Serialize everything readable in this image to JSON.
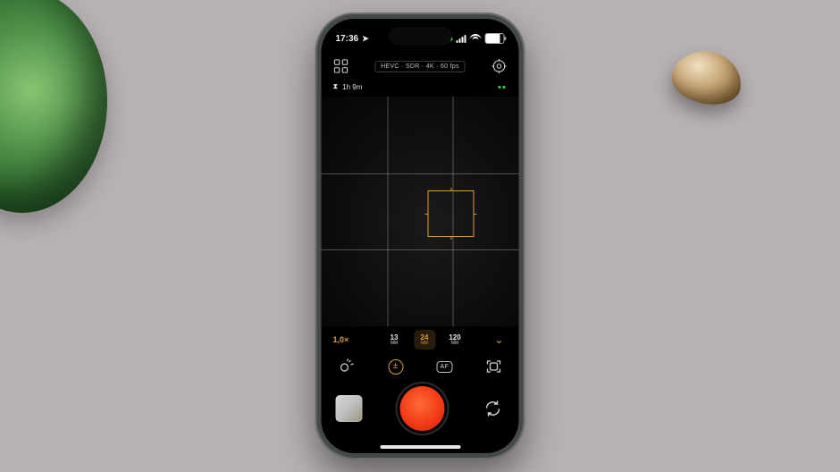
{
  "status": {
    "time": "17:36",
    "location_services": true,
    "battery_pct": 80
  },
  "header": {
    "format": "HEVC · SDR · 4K · 60 fps",
    "remaining": "1h 9m"
  },
  "lenses": {
    "zoom": "1,0×",
    "options": [
      {
        "mm": "13",
        "unit": "MM",
        "selected": false
      },
      {
        "mm": "24",
        "unit": "MM",
        "selected": true
      },
      {
        "mm": "120",
        "unit": "MM",
        "selected": false
      }
    ]
  },
  "tools": {
    "af": "AF"
  },
  "colors": {
    "accent": "#d7a03a",
    "record": "#f23b17"
  }
}
